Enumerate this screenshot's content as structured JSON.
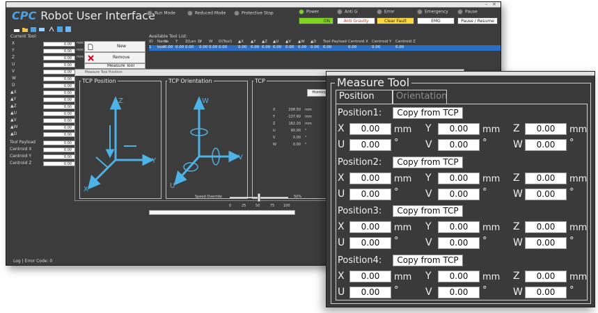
{
  "main": {
    "title": "Robot User Interface",
    "logo": "CPC",
    "modes": [
      "Run Mode",
      "Reduced Mode",
      "Protective Stop"
    ],
    "status_lights": [
      "Power",
      "Anti G",
      "Error",
      "Emergency",
      "Pause"
    ],
    "status_buttons": {
      "on": "ON",
      "anti_gravity": "Anti Gravity",
      "clear_fault": "Clear Fault",
      "emg": "EMG",
      "pause_resume": "Pause / Resume"
    },
    "current_tool_label": "Current Tool:",
    "current_tool_rows": [
      {
        "label": "X",
        "value": "0.00"
      },
      {
        "label": "Y",
        "value": "0.00"
      },
      {
        "label": "Z",
        "value": "0.00"
      },
      {
        "label": "U",
        "value": "0.00"
      },
      {
        "label": "V",
        "value": "0.00"
      },
      {
        "label": "W",
        "value": "0.00"
      },
      {
        "label": "D",
        "value": "0.00"
      },
      {
        "label": "▲X",
        "value": "0.00"
      },
      {
        "label": "▲Y",
        "value": "0.00"
      },
      {
        "label": "▲Z",
        "value": "0.00"
      },
      {
        "label": "▲U",
        "value": "0.00"
      },
      {
        "label": "▲V",
        "value": "0.00"
      },
      {
        "label": "▲W",
        "value": "0.00"
      },
      {
        "label": "▲D",
        "value": "0.00"
      },
      {
        "label": "Tool Payload",
        "value": "0.00"
      },
      {
        "label": "Centroid X",
        "value": "0.00"
      },
      {
        "label": "Centroid Y",
        "value": "0.00"
      },
      {
        "label": "Centroid Z",
        "value": "0.00"
      }
    ],
    "unit_mm": "mm",
    "side_buttons": {
      "new": "New",
      "remove": "Remove",
      "measure": "Measure Tool"
    },
    "available_label": "Available Tool List:",
    "table_headers": [
      "ID",
      "Name",
      "X",
      "Y",
      "Z(Len 1)",
      "V",
      "W",
      "D(Tool)",
      "▲X",
      "▲Y",
      "▲Z",
      "▲U",
      "▲V",
      "▲W",
      "▲D",
      "Tool Payload",
      "Centroid X",
      "Centroid Y",
      "Centroid Z"
    ],
    "table_row": [
      "1",
      "tool",
      "0.00",
      "0.00",
      "0.00",
      "0.00",
      "0.00",
      "0.00",
      "0.00",
      "0.00",
      "0.00",
      "0.00",
      "0.00",
      "0.00",
      "0.00",
      "0.00",
      "0.00",
      "0.00",
      "0.00"
    ],
    "status_bar": "Log | Error Code: 0"
  },
  "inner_dialog": {
    "title": "Measure Tool Position",
    "tcp_position": "TCP Position",
    "tcp_orientation": "TCP Orientation",
    "tcp": "TCP",
    "homing": "Homing",
    "tcp_values": [
      {
        "axis": "X",
        "value": "298.50",
        "unit": "mm"
      },
      {
        "axis": "Y",
        "value": "-137.60",
        "unit": "mm"
      },
      {
        "axis": "Z",
        "value": "182.20",
        "unit": "mm"
      },
      {
        "axis": "U",
        "value": "90.00",
        "unit": "°"
      },
      {
        "axis": "V",
        "value": "0.00",
        "unit": "°"
      },
      {
        "axis": "W",
        "value": "0.00",
        "unit": "°"
      }
    ],
    "speed_label": "Speed Override",
    "speed_value": "50%",
    "speed_fraction": 0.5,
    "speed_ticks": [
      "0",
      "25",
      "50",
      "75",
      "100"
    ],
    "axis_labels": {
      "z": "Z",
      "y": "Y",
      "x": "X",
      "w": "W",
      "v": "V",
      "u": "U",
      "plus": "+",
      "minus": "-"
    }
  },
  "measure_tool": {
    "title": "Measure Tool",
    "tabs": [
      "Position",
      "Orientation"
    ],
    "copy_label": "Copy from TCP",
    "unit_mm": "mm",
    "unit_deg": "°",
    "positions": [
      {
        "name": "Position1:",
        "x": "0.00",
        "y": "0.00",
        "z": "0.00",
        "u": "0.00",
        "v": "0.00",
        "w": "0.00"
      },
      {
        "name": "Position2:",
        "x": "0.00",
        "y": "0.00",
        "z": "0.00",
        "u": "0.00",
        "v": "0.00",
        "w": "0.00"
      },
      {
        "name": "Position3:",
        "x": "0.00",
        "y": "0.00",
        "z": "0.00",
        "u": "0.00",
        "v": "0.00",
        "w": "0.00"
      },
      {
        "name": "Position4:",
        "x": "0.00",
        "y": "0.00",
        "z": "0.00",
        "u": "0.00",
        "v": "0.00",
        "w": "0.00"
      }
    ],
    "axes": [
      "X",
      "Y",
      "Z",
      "U",
      "V",
      "W"
    ]
  },
  "colors": {
    "accent_blue": "#4d9fe0",
    "bg_dark": "#3c3c3c",
    "led_green": "#7ed321",
    "selection": "#2a6fc4"
  }
}
